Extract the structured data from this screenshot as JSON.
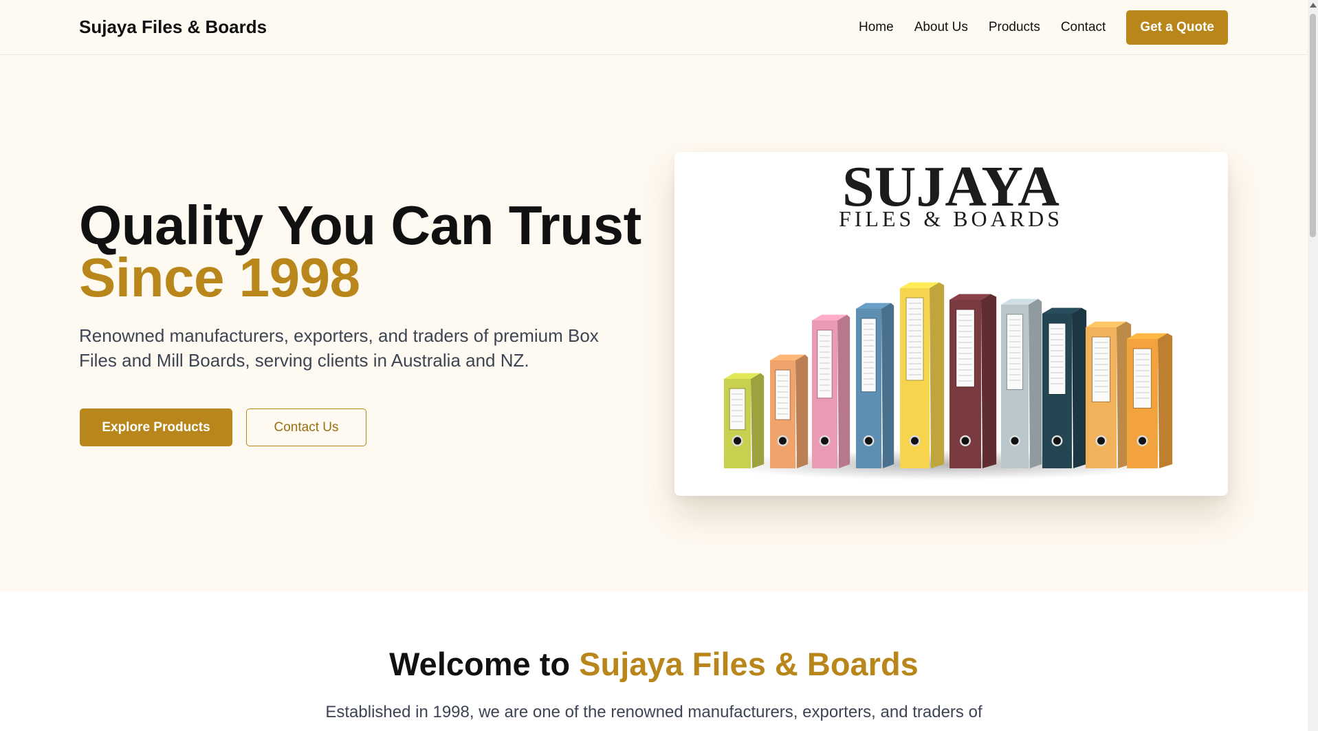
{
  "header": {
    "brand": "Sujaya Files & Boards",
    "nav": [
      "Home",
      "About Us",
      "Products",
      "Contact"
    ],
    "cta": "Get a Quote"
  },
  "hero": {
    "title_line1": "Quality You Can Trust",
    "title_line2": "Since 1998",
    "description": "Renowned manufacturers, exporters, and traders of premium Box Files and Mill Boards, serving clients in Australia and NZ.",
    "primary_button": "Explore Products",
    "secondary_button": "Contact Us",
    "image": {
      "logo_word": "SUJAYA",
      "logo_sub": "FILES & BOARDS"
    }
  },
  "welcome": {
    "title_prefix": "Welcome to ",
    "title_highlight": "Sujaya Files & Boards",
    "text": "Established in 1998, we are one of the renowned manufacturers, exporters, and traders of"
  },
  "colors": {
    "accent": "#b8861b",
    "background": "#fffaf1",
    "text": "#111111",
    "muted": "#3d4554"
  }
}
